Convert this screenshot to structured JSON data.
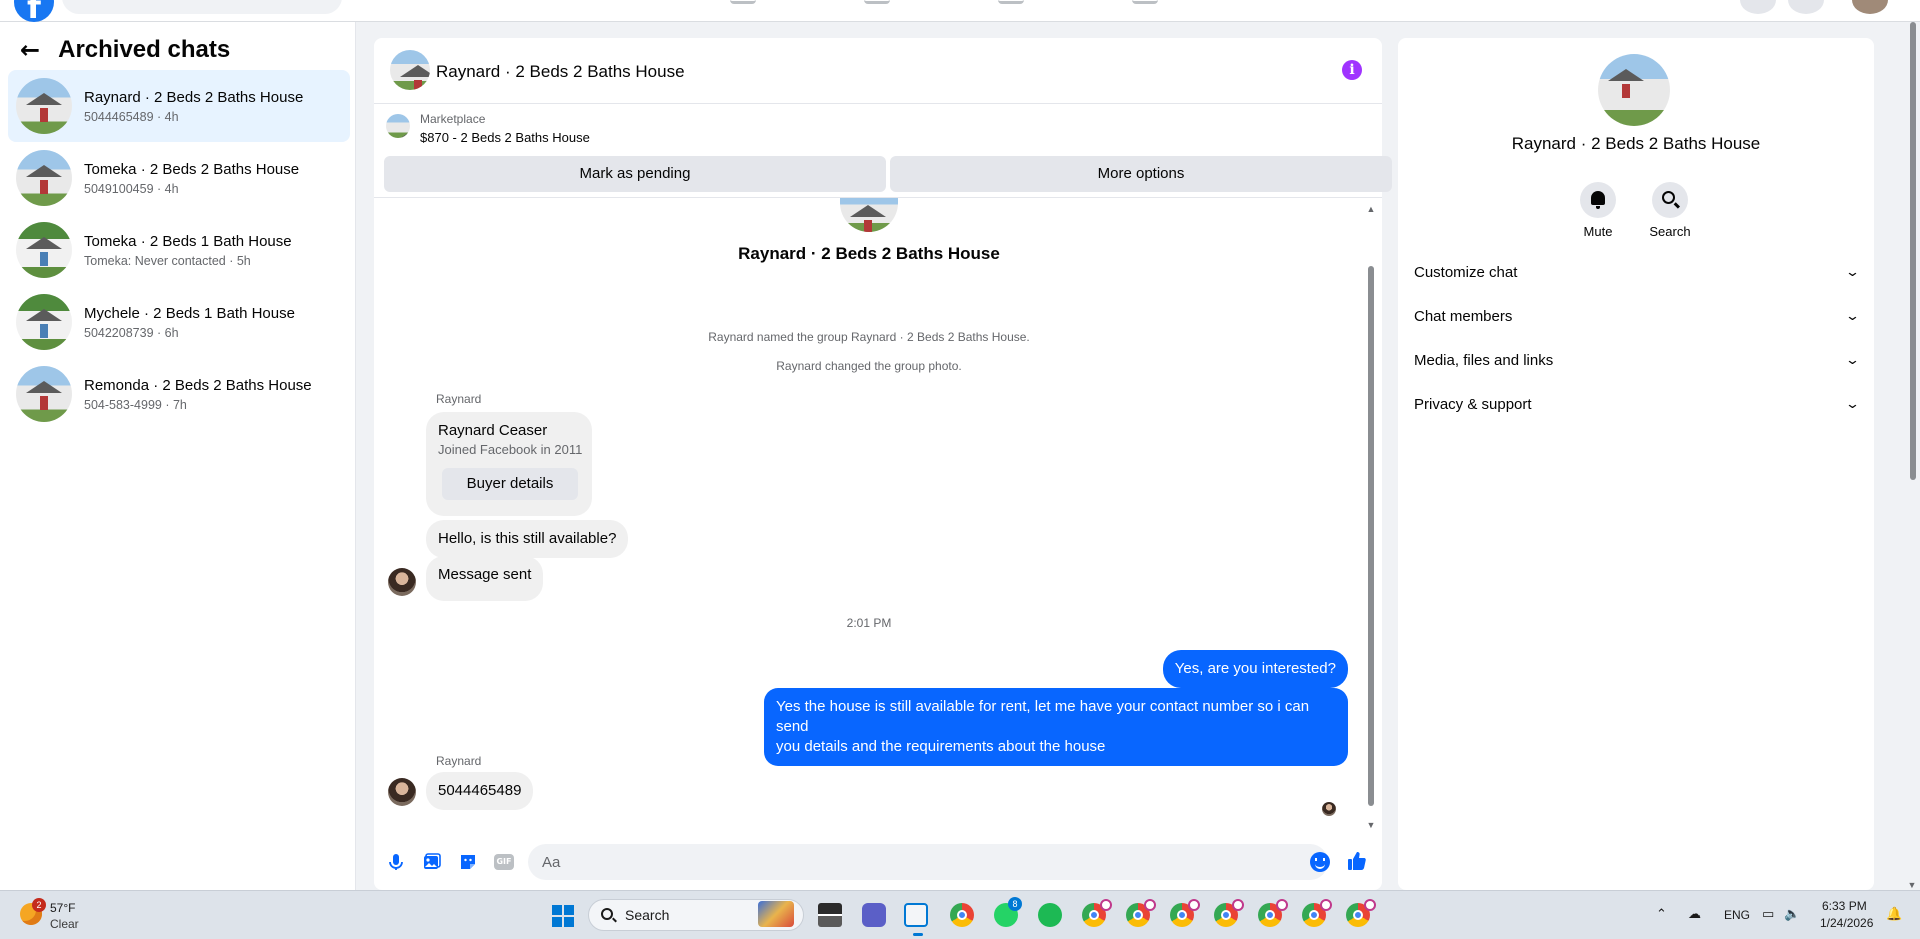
{
  "left_panel": {
    "title": "Archived chats",
    "chats": [
      {
        "name": "Raynard · 2 Beds 2 Baths House",
        "subtitle": "5044465489 · 4h",
        "active": true
      },
      {
        "name": "Tomeka · 2 Beds 2 Baths House",
        "subtitle": "5049100459 · 4h"
      },
      {
        "name": "Tomeka · 2 Beds 1 Bath House",
        "subtitle": "Tomeka: Never contacted · 5h"
      },
      {
        "name": "Mychele · 2 Beds 1 Bath House",
        "subtitle": "5042208739 · 6h"
      },
      {
        "name": "Remonda · 2 Beds 2 Baths House",
        "subtitle": "504-583-4999 · 7h"
      }
    ]
  },
  "conversation": {
    "title": "Raynard · 2 Beds 2 Baths House",
    "marketplace": {
      "label": "Marketplace",
      "item": "$870 - 2 Beds 2 Baths House",
      "pending_button": "Mark as pending",
      "more_button": "More options"
    },
    "group_title": "Raynard · 2 Beds 2 Baths House",
    "system_messages": [
      "Raynard named the group Raynard · 2 Beds 2 Baths House.",
      "Raynard changed the group photo."
    ],
    "sender_name": "Raynard",
    "buyer_card": {
      "name": "Raynard Ceaser",
      "joined": "Joined Facebook in 2011",
      "button": "Buyer details"
    },
    "incoming_1": "Hello, is this still available?",
    "incoming_2": "Message sent",
    "timestamp": "2:01 PM",
    "outgoing_1": "Yes, are you interested?",
    "outgoing_2_line1": "Yes the house is still available for rent, let me have your contact number so i can send",
    "outgoing_2_line2": "you details and the requirements about the house",
    "incoming_3": "5044465489",
    "composer_placeholder": "Aa",
    "composer_icons": [
      "microphone-icon",
      "image-icon",
      "sticker-icon",
      "gif-icon",
      "emoji-icon",
      "thumbs-up-icon"
    ],
    "gif_label": "GIF"
  },
  "right_panel": {
    "name": "Raynard · 2 Beds 2 Baths House",
    "actions": [
      {
        "label": "Mute",
        "icon": "bell-icon"
      },
      {
        "label": "Search",
        "icon": "search-icon"
      }
    ],
    "sections": [
      "Customize chat",
      "Chat members",
      "Media, files and links",
      "Privacy & support"
    ]
  },
  "taskbar": {
    "weather_temp": "57°F",
    "weather_condition": "Clear",
    "weather_badge": "2",
    "search_label": "Search",
    "whatsapp_badge": "8",
    "language": "ENG",
    "time": "6:33 PM",
    "date": "1/24/2026"
  },
  "colors": {
    "accent": "#0866ff",
    "info": "#a033ff",
    "active_chat": "#e7f3ff"
  }
}
